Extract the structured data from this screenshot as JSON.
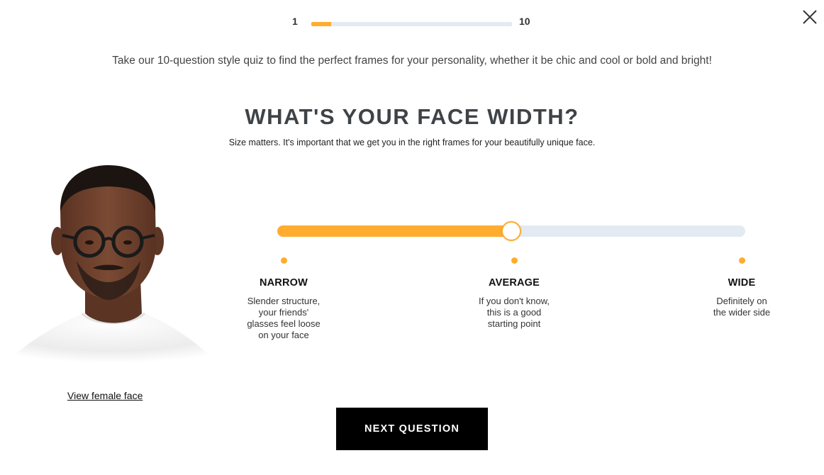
{
  "progress": {
    "start_label": "1",
    "end_label": "10",
    "current": 1,
    "total": 10
  },
  "intro_text": "Take our 10-question style quiz to find the perfect frames for your personality, whether it be chic and cool or bold and bright!",
  "question": {
    "title": "WHAT'S YOUR FACE WIDTH?",
    "subtitle": "Size matters. It's important that we get you in the right frames for your beautifully unique face."
  },
  "face_toggle_link": "View female face",
  "slider": {
    "selected_index": 1,
    "fill_fraction": 0.5
  },
  "options": [
    {
      "label": "NARROW",
      "desc": [
        "Slender structure,",
        "your friends'",
        "glasses feel loose",
        "on your face"
      ]
    },
    {
      "label": "AVERAGE",
      "desc": [
        "If you don't know,",
        "this is a good",
        "starting point"
      ]
    },
    {
      "label": "WIDE",
      "desc": [
        "Definitely on",
        "the wider side"
      ]
    }
  ],
  "next_button": "NEXT QUESTION",
  "colors": {
    "accent": "#ffac2f",
    "track": "#e3eaf1",
    "button": "#000000"
  },
  "icons": {
    "close": "close-icon"
  }
}
